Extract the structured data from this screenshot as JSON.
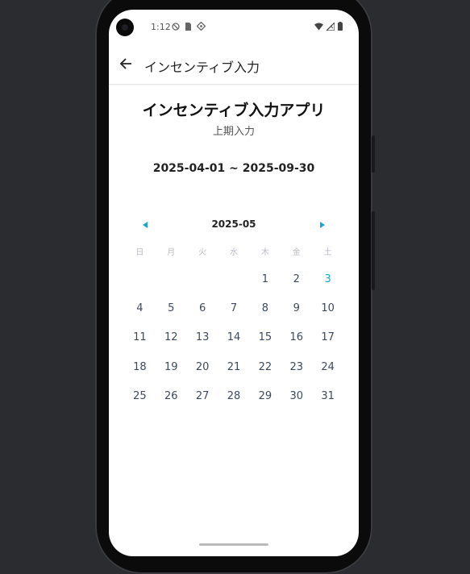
{
  "status_bar": {
    "time": "1:12",
    "icons_left": [
      "do-not-disturb-icon",
      "sim-card-icon",
      "location-icon"
    ],
    "icons_right": [
      "wifi-icon",
      "signal-icon",
      "battery-icon"
    ]
  },
  "appbar": {
    "title": "インセンティブ入力"
  },
  "page": {
    "title": "インセンティブ入力アプリ",
    "subtitle": "上期入力",
    "date_range": "2025-04-01 ~ 2025-09-30"
  },
  "calendar": {
    "month": "2025-05",
    "weekdays": [
      "日",
      "月",
      "火",
      "水",
      "木",
      "金",
      "土"
    ],
    "weeks": [
      [
        "",
        "",
        "",
        "",
        "1",
        "2",
        "3"
      ],
      [
        "4",
        "5",
        "6",
        "7",
        "8",
        "9",
        "10"
      ],
      [
        "11",
        "12",
        "13",
        "14",
        "15",
        "16",
        "17"
      ],
      [
        "18",
        "19",
        "20",
        "21",
        "22",
        "23",
        "24"
      ],
      [
        "25",
        "26",
        "27",
        "28",
        "29",
        "30",
        "31"
      ]
    ],
    "highlighted_day": "3",
    "accent_color": "#1aa7cf"
  }
}
